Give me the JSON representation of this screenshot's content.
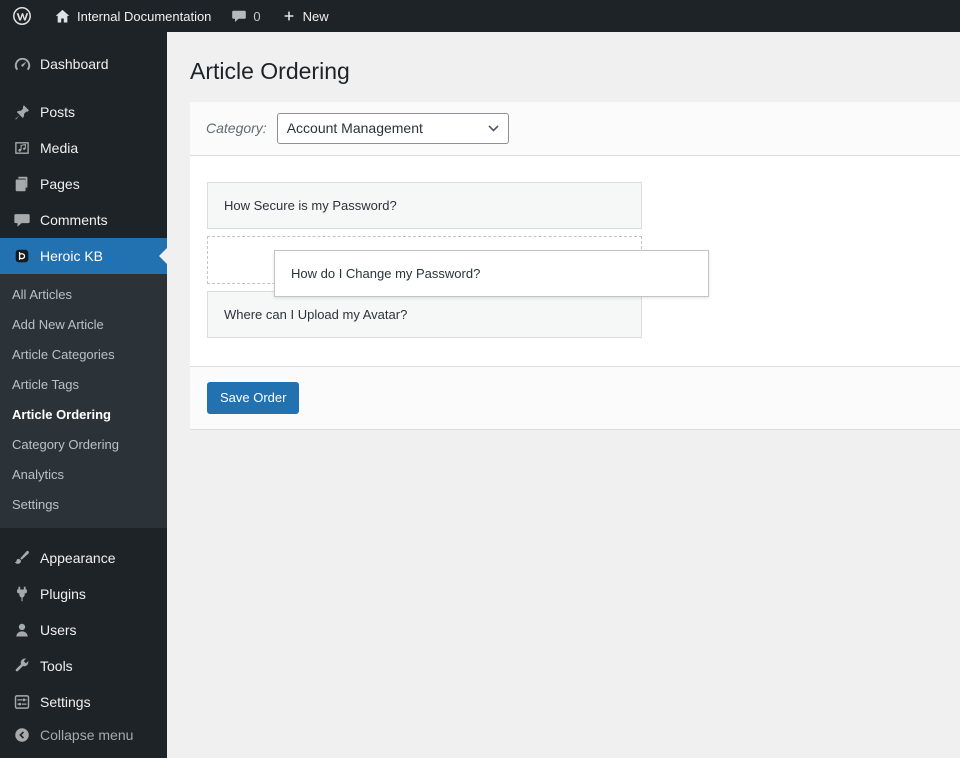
{
  "colors": {
    "accent": "#2271b1",
    "admin_bar_bg": "#1d2327",
    "sidebar_bg": "#1d2327",
    "submenu_bg": "#2c3338",
    "content_bg": "#f0f0f1",
    "panel_bg": "#ffffff",
    "item_bg": "#f6f7f7",
    "border": "#dcdcde"
  },
  "admin_bar": {
    "site_name": "Internal Documentation",
    "comments_count": "0",
    "new_label": "New"
  },
  "sidebar": {
    "items": [
      "Dashboard",
      "Posts",
      "Media",
      "Pages",
      "Comments",
      "Heroic KB",
      "Appearance",
      "Plugins",
      "Users",
      "Tools",
      "Settings",
      "Collapse menu"
    ],
    "submenu": [
      "All Articles",
      "Add New Article",
      "Article Categories",
      "Article Tags",
      "Article Ordering",
      "Category Ordering",
      "Analytics",
      "Settings"
    ],
    "active_item": "Heroic KB",
    "active_submenu": "Article Ordering"
  },
  "main": {
    "page_title": "Article Ordering",
    "category_label": "Category:",
    "category_value": "Account Management",
    "articles": [
      "How Secure is my Password?",
      "How do I Change my Password?",
      "Where can I Upload my Avatar?"
    ],
    "save_button": "Save Order"
  }
}
